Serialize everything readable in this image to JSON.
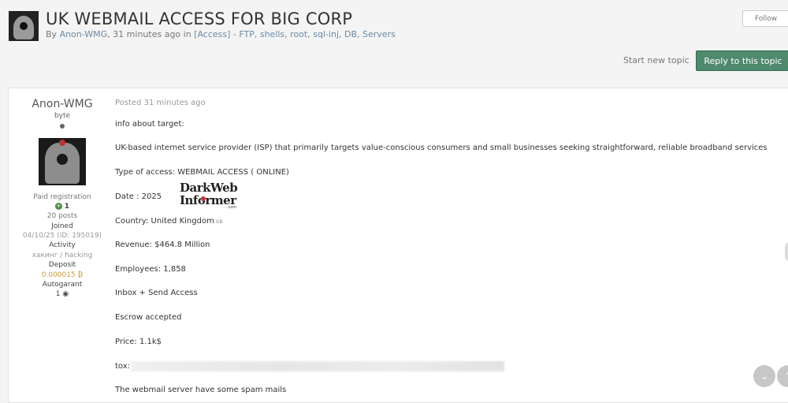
{
  "topic": {
    "title": "UK WEBMAIL ACCESS FOR BIG CORP",
    "meta_by": "By ",
    "meta_author": "Anon-WMG",
    "meta_time": ", 31 minutes ago in ",
    "meta_category": "[Access] - FTP, shells, root, sql-inj, DB, Servers",
    "follow_label": "Follow",
    "start_new_label": "Start new topic",
    "reply_label": "Reply to this topic"
  },
  "author": {
    "name": "Anon-WMG",
    "rank": "byte",
    "registration": "Paid registration",
    "reputation": "1",
    "posts": "20 posts",
    "joined_label": "Joined",
    "joined_value": "04/10/25 (ID: 195019)",
    "activity_label": "Activity",
    "activity_value": "хакинг / hacking",
    "deposit_label": "Deposit",
    "deposit_value": "0.000015 ₿",
    "autogarant_label": "Autogarant",
    "autogarant_value": "1"
  },
  "post": {
    "date": "Posted 31 minutes ago",
    "lines": [
      "info about target:",
      "UK-based internet service provider (ISP) that primarily targets value-conscious consumers and small businesses seeking straightforward, reliable broadband services",
      "Type of access: WEBMAIL ACCESS ( ONLINE)",
      "Date : 2025",
      "Country: United Kingdom",
      "Revenue: $464.8 Million",
      "Employees: 1,858",
      "Inbox + Send Access",
      "Escrow accepted",
      "Price: 1.1k$",
      "tox:",
      "The webmail server have some spam mails"
    ],
    "country_code": "GB"
  },
  "watermark": {
    "line1": "DarkWeb",
    "line2": "Informer",
    "domain": ".com"
  },
  "icons": {
    "scroll_down": "chevron-down-icon",
    "reputation": "plus-circle-icon",
    "autogarant": "eye-icon",
    "bitcoin": "bitcoin-icon"
  },
  "colors": {
    "reply_button": "#4f8a6d",
    "link": "#6b8aa6",
    "deposit": "#c99a3c",
    "reputation": "#4a8f4a"
  }
}
